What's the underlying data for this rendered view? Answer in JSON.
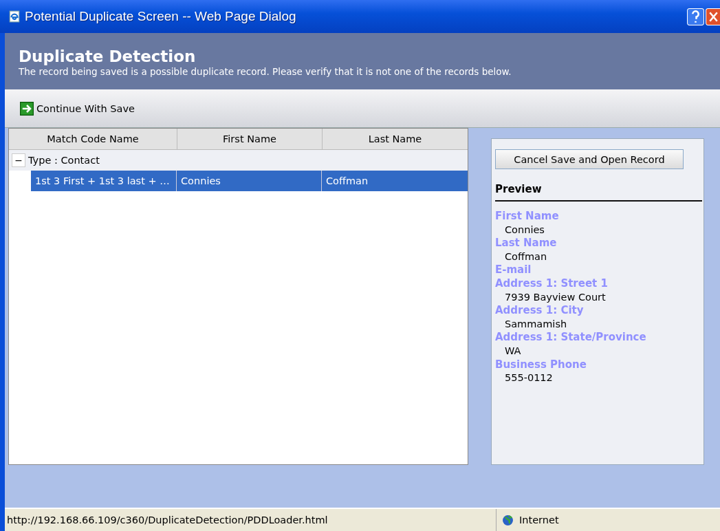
{
  "window": {
    "title": "Potential Duplicate Screen -- Web Page Dialog"
  },
  "header": {
    "title": "Duplicate Detection",
    "message": "The record being saved is a possible duplicate record. Please verify that it is not one of the records below."
  },
  "toolbar": {
    "button": "Continue With Save"
  },
  "table": {
    "columns": [
      "Match Code Name",
      "First Name",
      "Last Name"
    ],
    "groups": [
      {
        "toggle": "−",
        "label": "Type : Contact",
        "expanded": true,
        "rows": [
          {
            "cells": [
              "1st 3 First +  1st 3 last + …",
              "Connies",
              "Coffman"
            ],
            "selected": true
          }
        ]
      }
    ]
  },
  "side": {
    "button": "Cancel Save and Open Record",
    "preview_title": "Preview",
    "fields": [
      {
        "label": "First Name",
        "value": "Connies"
      },
      {
        "label": "Last Name",
        "value": "Coffman"
      },
      {
        "label": "E-mail"
      },
      {
        "label": "Address 1: Street 1",
        "value": "7939 Bayview Court"
      },
      {
        "label": "Address 1: City",
        "value": "Sammamish"
      },
      {
        "label": "Address 1: State/Province",
        "value": "WA"
      },
      {
        "label": "Business Phone",
        "value": "555-0112"
      }
    ]
  },
  "status_bar": {
    "url": "http://192.168.66.109/c360/DuplicateDetection/PDDLoader.html",
    "zone": "Internet"
  }
}
